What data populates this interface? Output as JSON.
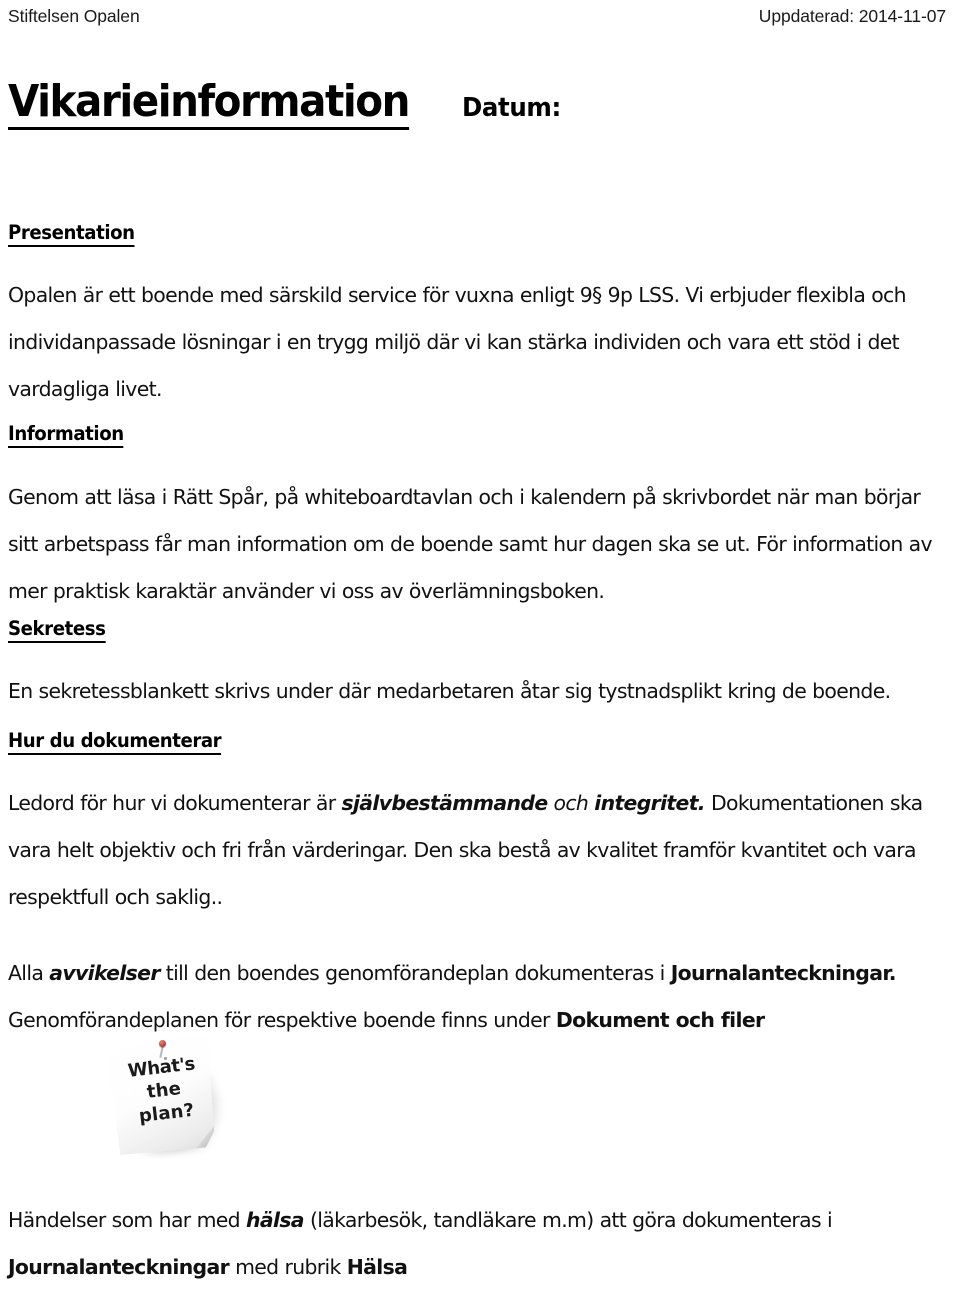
{
  "header": {
    "organization": "Stiftelsen Opalen",
    "updated": "Uppdaterad: 2014-11-07"
  },
  "title": {
    "main": "Vikarieinformation",
    "date_label": "Datum:"
  },
  "sections": {
    "presentation": {
      "heading": "Presentation",
      "body": "Opalen är ett boende med särskild service för vuxna enligt 9§ 9p LSS. Vi erbjuder flexibla och individanpassade lösningar i en trygg miljö där vi kan stärka individen och vara ett stöd i det vardagliga livet."
    },
    "information": {
      "heading": "Information",
      "body": "Genom att läsa i Rätt Spår, på whiteboardtavlan och i kalendern på skrivbordet när man börjar sitt arbetspass får man information om de boende samt hur dagen ska se ut. För information av mer praktisk karaktär använder vi oss av överlämningsboken."
    },
    "sekretess": {
      "heading": "Sekretess",
      "body": "En sekretessblankett skrivs under där medarbetaren åtar sig tystnadsplikt kring de boende."
    },
    "dokumentation": {
      "heading": "Hur du dokumenterar",
      "body_part1": "Ledord för hur vi dokumenterar är ",
      "emph1": "självbestämmande",
      "body_part2": " och ",
      "emph2": "integritet.",
      "body_part3": " Dokumentationen ska vara helt objektiv och fri från värderingar. Den ska bestå av kvalitet framför kvantitet och vara respektfull och saklig.."
    },
    "avvikelser": {
      "part1": "Alla ",
      "emph1": "avvikelser",
      "part2": " till den boendes genomförandeplan dokumenteras i ",
      "strong1": "Journalanteckningar."
    },
    "genomforandeplan": {
      "part1": "Genomförandeplanen för respektive boende finns under ",
      "strong1": "Dokument och filer"
    },
    "handelser": {
      "part1": "Händelser som har med ",
      "emph1": "hälsa",
      "part2": " (läkarbesök, tandläkare m.m) att göra dokumenteras i ",
      "strong1": "Journalanteckningar",
      "part3": " med rubrik ",
      "strong2": "Hälsa"
    }
  },
  "figure": {
    "alt": "sticky-note-whats-the-plan",
    "line1": "What's",
    "line2": "the",
    "line3": "plan?"
  }
}
